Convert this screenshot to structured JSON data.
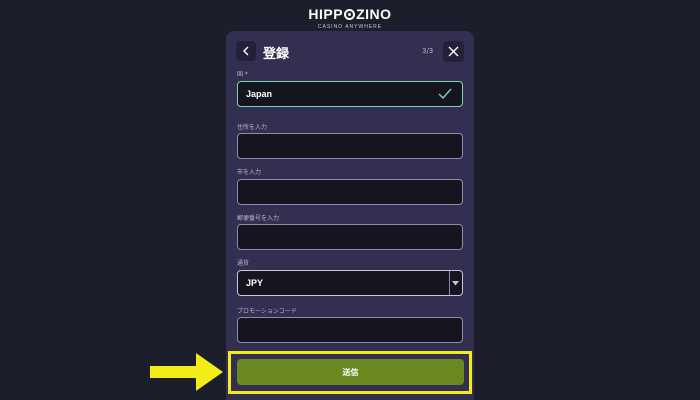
{
  "logo": {
    "main_left": "HIPP",
    "main_right": "ZINO",
    "tagline": "CASINO ANYWHERE"
  },
  "header": {
    "back_icon": "chevron-left-icon",
    "title": "登録",
    "step": "3/3",
    "close_icon": "close-icon"
  },
  "fields": {
    "country": {
      "label": "国 *",
      "value": "Japan",
      "status_icon": "check-icon"
    },
    "address": {
      "label": "住所を入力",
      "value": ""
    },
    "city": {
      "label": "市を入力",
      "value": ""
    },
    "postal": {
      "label": "郵便番号を入力",
      "value": ""
    },
    "currency": {
      "label": "通貨",
      "value": "JPY",
      "dropdown_icon": "caret-down-icon"
    },
    "promo": {
      "label": "プロモーションコード",
      "value": ""
    }
  },
  "submit": {
    "label": "送信"
  },
  "colors": {
    "background": "#1c1e2c",
    "panel": "#322f50",
    "accent_button": "#6a8a21",
    "highlight": "#f2ec17",
    "valid": "#7fd3b3"
  }
}
